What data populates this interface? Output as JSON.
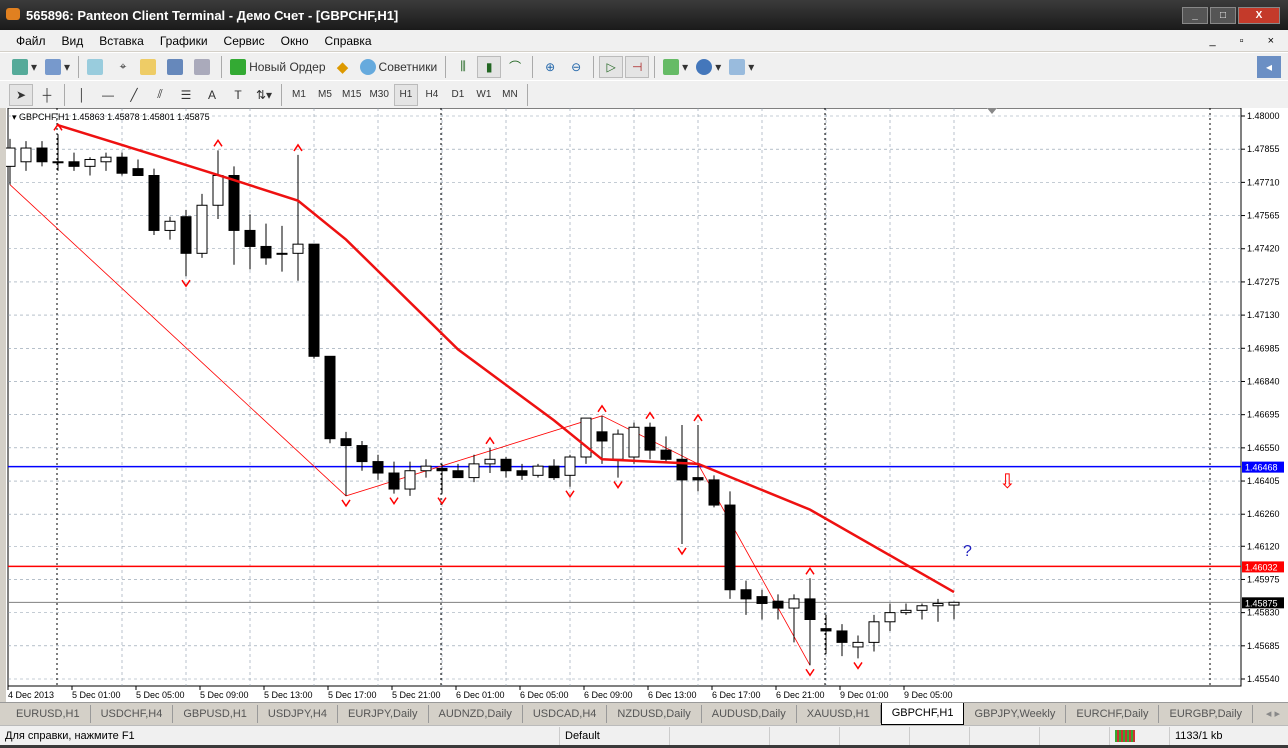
{
  "window": {
    "title": "565896: Panteon Client Terminal - Демо Счет - [GBPCHF,H1]",
    "buttons": [
      "_",
      "□",
      "X"
    ]
  },
  "menu": [
    "Файл",
    "Вид",
    "Вставка",
    "Графики",
    "Сервис",
    "Окно",
    "Справка"
  ],
  "mdi_controls": [
    "_",
    "▫",
    "×"
  ],
  "toolbar": {
    "new_order": "Новый Ордер",
    "experts": "Советники"
  },
  "timeframes": [
    "M1",
    "M5",
    "M15",
    "M30",
    "H1",
    "H4",
    "D1",
    "W1",
    "MN"
  ],
  "active_timeframe": "H1",
  "chart": {
    "header": "GBPCHF,H1  1.45863 1.45878 1.45801 1.45875"
  },
  "chart_data": {
    "type": "candlestick",
    "symbol": "GBPCHF",
    "timeframe": "H1",
    "ylim": [
      1.4554,
      1.48
    ],
    "price_ticks": [
      "1.48000",
      "1.47855",
      "1.47710",
      "1.47565",
      "1.47420",
      "1.47275",
      "1.47130",
      "1.46985",
      "1.46840",
      "1.46695",
      "1.46550",
      "1.46405",
      "1.46260",
      "1.46120",
      "1.45975",
      "1.45830",
      "1.45685",
      "1.45540"
    ],
    "time_labels": [
      "4 Dec 2013",
      "5 Dec 01:00",
      "5 Dec 05:00",
      "5 Dec 09:00",
      "5 Dec 13:00",
      "5 Dec 17:00",
      "5 Dec 21:00",
      "6 Dec 01:00",
      "6 Dec 05:00",
      "6 Dec 09:00",
      "6 Dec 13:00",
      "6 Dec 17:00",
      "6 Dec 21:00",
      "9 Dec 01:00",
      "9 Dec 05:00"
    ],
    "ohlc": [
      [
        1.4778,
        1.479,
        1.477,
        1.4786
      ],
      [
        1.478,
        1.4789,
        1.4776,
        1.4786
      ],
      [
        1.4786,
        1.4789,
        1.4778,
        1.478
      ],
      [
        1.478,
        1.4792,
        1.4776,
        1.478
      ],
      [
        1.478,
        1.4784,
        1.4776,
        1.4778
      ],
      [
        1.4778,
        1.4782,
        1.4774,
        1.4781
      ],
      [
        1.478,
        1.4784,
        1.4776,
        1.4782
      ],
      [
        1.4782,
        1.4784,
        1.4774,
        1.4775
      ],
      [
        1.4777,
        1.4781,
        1.4774,
        1.4774
      ],
      [
        1.4774,
        1.4777,
        1.4748,
        1.475
      ],
      [
        1.475,
        1.4756,
        1.4746,
        1.4754
      ],
      [
        1.4756,
        1.4759,
        1.473,
        1.474
      ],
      [
        1.474,
        1.4766,
        1.4738,
        1.4761
      ],
      [
        1.4761,
        1.4785,
        1.4755,
        1.4774
      ],
      [
        1.4774,
        1.4778,
        1.4735,
        1.475
      ],
      [
        1.475,
        1.4757,
        1.4733,
        1.4743
      ],
      [
        1.4743,
        1.4753,
        1.4735,
        1.4738
      ],
      [
        1.474,
        1.4752,
        1.4732,
        1.474
      ],
      [
        1.474,
        1.4783,
        1.4728,
        1.4744
      ],
      [
        1.4744,
        1.4744,
        1.4694,
        1.4695
      ],
      [
        1.4695,
        1.4695,
        1.4657,
        1.4659
      ],
      [
        1.4659,
        1.4662,
        1.4634,
        1.4656
      ],
      [
        1.4656,
        1.4658,
        1.4645,
        1.4649
      ],
      [
        1.4649,
        1.4652,
        1.4641,
        1.4644
      ],
      [
        1.4644,
        1.4649,
        1.4635,
        1.4637
      ],
      [
        1.4637,
        1.4649,
        1.4634,
        1.4645
      ],
      [
        1.4645,
        1.465,
        1.4642,
        1.4647
      ],
      [
        1.4646,
        1.4648,
        1.4635,
        1.4645
      ],
      [
        1.4645,
        1.4648,
        1.4642,
        1.4642
      ],
      [
        1.4642,
        1.4652,
        1.464,
        1.4648
      ],
      [
        1.4648,
        1.4655,
        1.4644,
        1.465
      ],
      [
        1.465,
        1.4651,
        1.4642,
        1.4645
      ],
      [
        1.4645,
        1.4648,
        1.4641,
        1.4643
      ],
      [
        1.4643,
        1.4648,
        1.4642,
        1.4647
      ],
      [
        1.4647,
        1.465,
        1.4641,
        1.4642
      ],
      [
        1.4643,
        1.4652,
        1.4638,
        1.4651
      ],
      [
        1.4651,
        1.4668,
        1.4648,
        1.4668
      ],
      [
        1.4662,
        1.4669,
        1.4648,
        1.4658
      ],
      [
        1.465,
        1.4663,
        1.4642,
        1.4661
      ],
      [
        1.4651,
        1.4666,
        1.4648,
        1.4664
      ],
      [
        1.4664,
        1.4666,
        1.465,
        1.4654
      ],
      [
        1.4654,
        1.466,
        1.4649,
        1.465
      ],
      [
        1.465,
        1.4665,
        1.4613,
        1.4641
      ],
      [
        1.4642,
        1.4665,
        1.4636,
        1.4641
      ],
      [
        1.4641,
        1.4643,
        1.4629,
        1.463
      ],
      [
        1.463,
        1.4636,
        1.4589,
        1.4593
      ],
      [
        1.4593,
        1.4597,
        1.4582,
        1.4589
      ],
      [
        1.459,
        1.4593,
        1.458,
        1.4587
      ],
      [
        1.4588,
        1.4591,
        1.458,
        1.4585
      ],
      [
        1.4585,
        1.4591,
        1.457,
        1.4589
      ],
      [
        1.4589,
        1.4598,
        1.456,
        1.458
      ],
      [
        1.4576,
        1.4582,
        1.4565,
        1.4575
      ],
      [
        1.4575,
        1.4578,
        1.4564,
        1.457
      ],
      [
        1.4568,
        1.4573,
        1.4563,
        1.457
      ],
      [
        1.457,
        1.4582,
        1.4566,
        1.4579
      ],
      [
        1.4579,
        1.4587,
        1.4575,
        1.4583
      ],
      [
        1.4583,
        1.4587,
        1.4582,
        1.4584
      ],
      [
        1.4584,
        1.4587,
        1.458,
        1.4586
      ],
      [
        1.4586,
        1.4589,
        1.4579,
        1.4587
      ],
      [
        1.45863,
        1.45878,
        1.45801,
        1.45875
      ]
    ],
    "ma": [
      [
        3,
        1.4796
      ],
      [
        9,
        1.4783
      ],
      [
        14,
        1.4772
      ],
      [
        18,
        1.4763
      ],
      [
        21,
        1.4746
      ],
      [
        28,
        1.4698
      ],
      [
        34,
        1.4667
      ],
      [
        37,
        1.465
      ],
      [
        43,
        1.4648
      ],
      [
        50,
        1.4628
      ],
      [
        56,
        1.4604
      ],
      [
        59,
        1.4592
      ]
    ],
    "zigzag": [
      [
        0,
        1.477
      ],
      [
        21,
        1.4634
      ],
      [
        37,
        1.4669
      ],
      [
        43,
        1.4648
      ],
      [
        50,
        1.456
      ]
    ],
    "up_arrows": [
      3,
      13,
      18,
      30,
      37,
      40,
      43,
      50
    ],
    "down_arrows": [
      11,
      21,
      24,
      27,
      35,
      38,
      42,
      50,
      53
    ],
    "hlines": [
      {
        "price": "1.46468",
        "color": "#0000ff"
      },
      {
        "price": "1.46032",
        "color": "#ff0000"
      },
      {
        "price": "1.45875",
        "color": "#808080"
      }
    ],
    "sell_arrow_label": "⇩",
    "question_mark": "?"
  },
  "tabs": [
    "EURUSD,H1",
    "USDCHF,H4",
    "GBPUSD,H1",
    "USDJPY,H4",
    "EURJPY,Daily",
    "AUDNZD,Daily",
    "USDCAD,H4",
    "NZDUSD,Daily",
    "AUDUSD,Daily",
    "XAUUSD,H1",
    "GBPCHF,H1",
    "GBPJPY,Weekly",
    "EURCHF,Daily",
    "EURGBP,Daily"
  ],
  "active_tab": "GBPCHF,H1",
  "status": {
    "help": "Для справки, нажмите F1",
    "profile": "Default",
    "traffic": "1133/1 kb"
  }
}
